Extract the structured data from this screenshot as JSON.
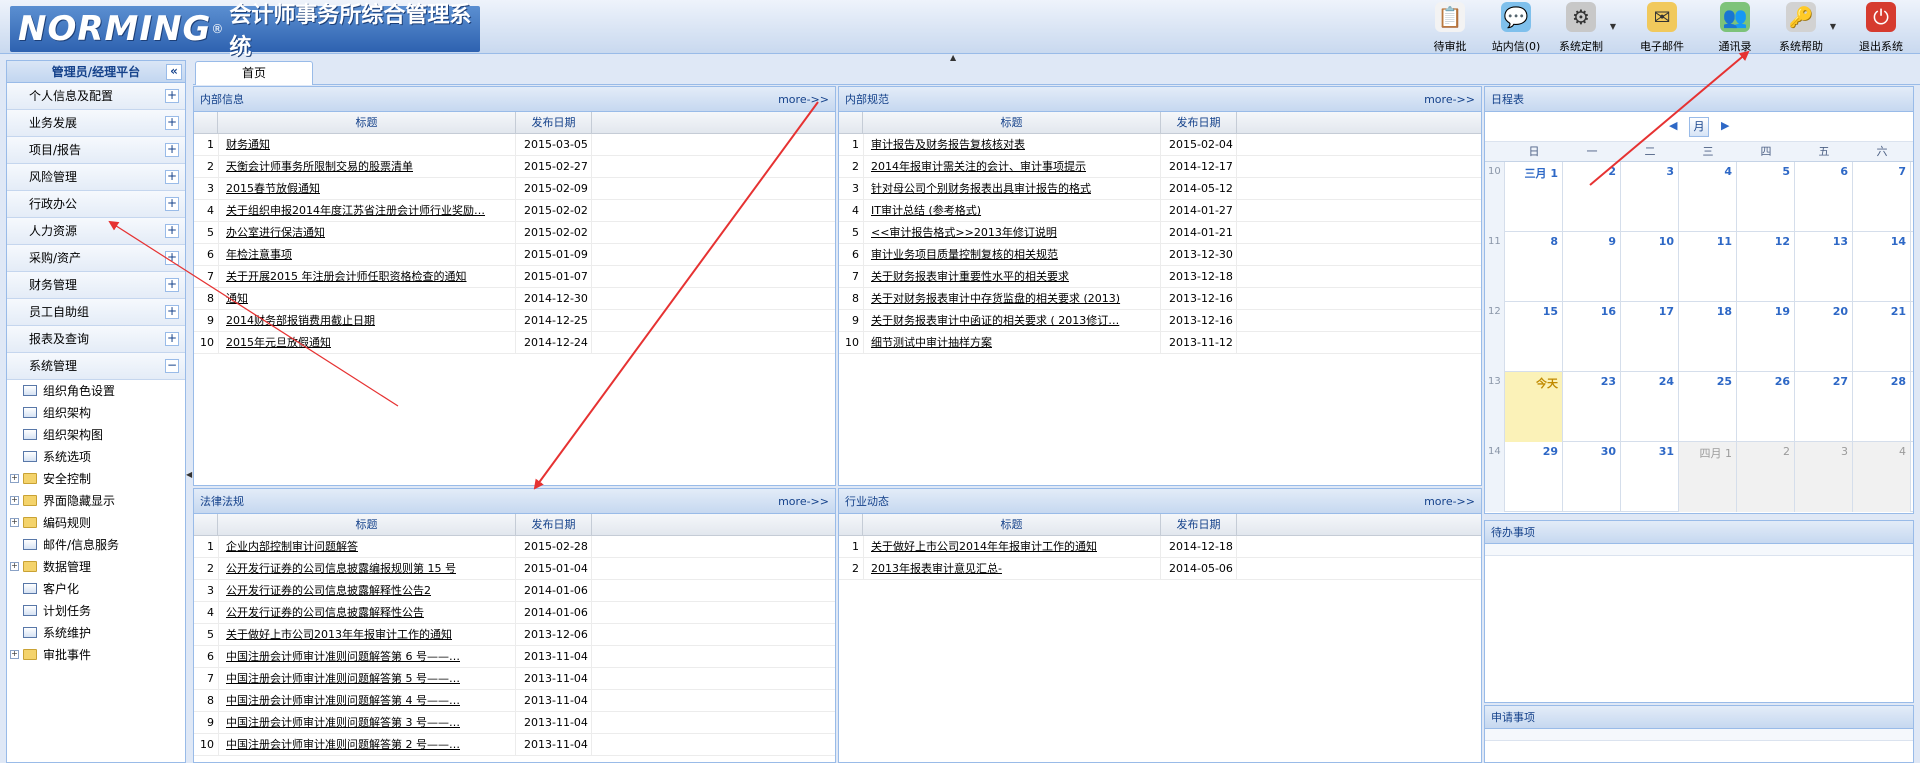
{
  "header": {
    "logo_brand": "NORMING",
    "logo_reg": "®",
    "logo_title": "会计师事务所综合管理系统",
    "tools": [
      {
        "label": "待审批",
        "icon": "clipboard-icon",
        "color": "#f3f3f3"
      },
      {
        "label": "站内信(0)",
        "icon": "chat-bubble-icon",
        "color": "#7fc0ec"
      },
      {
        "label": "系统定制",
        "icon": "gear-icon",
        "color": "#c8c8c8"
      },
      {
        "label": "电子邮件",
        "icon": "envelope-icon",
        "color": "#f1c95c"
      },
      {
        "label": "通讯录",
        "icon": "contacts-icon",
        "color": "#7dc37a"
      },
      {
        "label": "系统帮助",
        "icon": "key-icon",
        "color": "#d2d2d2"
      },
      {
        "label": "退出系统",
        "icon": "power-icon",
        "color": "#d63b2f"
      }
    ]
  },
  "left_nav": {
    "title": "管理员/经理平台",
    "collapse_symbol": "«",
    "plus_symbol": "+",
    "minus_symbol": "−",
    "menu_items": [
      "个人信息及配置",
      "业务发展",
      "项目/报告",
      "风险管理",
      "行政办公",
      "人力资源",
      "采购/资产",
      "财务管理",
      "员工自助组",
      "报表及查询",
      "系统管理"
    ],
    "tree_items": [
      {
        "label": "组织角色设置",
        "type": "doc"
      },
      {
        "label": "组织架构",
        "type": "doc"
      },
      {
        "label": "组织架构图",
        "type": "doc"
      },
      {
        "label": "系统选项",
        "type": "doc"
      },
      {
        "label": "安全控制",
        "type": "folder"
      },
      {
        "label": "界面隐藏显示",
        "type": "folder"
      },
      {
        "label": "编码规则",
        "type": "folder"
      },
      {
        "label": "邮件/信息服务",
        "type": "doc"
      },
      {
        "label": "数据管理",
        "type": "folder"
      },
      {
        "label": "客户化",
        "type": "doc"
      },
      {
        "label": "计划任务",
        "type": "doc"
      },
      {
        "label": "系统维护",
        "type": "doc"
      },
      {
        "label": "审批事件",
        "type": "folder"
      }
    ]
  },
  "tab": {
    "label": "首页"
  },
  "table_headers": {
    "title": "标题",
    "date": "发布日期"
  },
  "more_label": "more->>",
  "panels": [
    {
      "title": "内部信息",
      "rows": [
        [
          "1",
          "财务通知",
          "2015-03-05"
        ],
        [
          "2",
          "天衡会计师事务所限制交易的股票清单",
          "2015-02-27"
        ],
        [
          "3",
          "2015春节放假通知",
          "2015-02-09"
        ],
        [
          "4",
          "关于组织申报2014年度江苏省注册会计师行业奖励…",
          "2015-02-02"
        ],
        [
          "5",
          "办公室进行保洁通知",
          "2015-02-02"
        ],
        [
          "6",
          "年检注意事项",
          "2015-01-09"
        ],
        [
          "7",
          "关于开展2015 年注册会计师任职资格检查的通知",
          "2015-01-07"
        ],
        [
          "8",
          "通知",
          "2014-12-30"
        ],
        [
          "9",
          "2014财务部报销费用截止日期",
          "2014-12-25"
        ],
        [
          "10",
          "2015年元旦放假通知",
          "2014-12-24"
        ]
      ]
    },
    {
      "title": "内部规范",
      "rows": [
        [
          "1",
          "审计报告及财务报告复核核对表",
          "2015-02-04"
        ],
        [
          "2",
          "2014年报审计需关注的会计、审计事项提示",
          "2014-12-17"
        ],
        [
          "3",
          "针对母公司个别财务报表出具审计报告的格式",
          "2014-05-12"
        ],
        [
          "4",
          "IT审计总结 (参考格式)",
          "2014-01-27"
        ],
        [
          "5",
          "<<审计报告格式>>2013年修订说明",
          "2014-01-21"
        ],
        [
          "6",
          "审计业务项目质量控制复核的相关规范",
          "2013-12-30"
        ],
        [
          "7",
          "关于财务报表审计重要性水平的相关要求",
          "2013-12-18"
        ],
        [
          "8",
          "关于对财务报表审计中存货监盘的相关要求 (2013)",
          "2013-12-16"
        ],
        [
          "9",
          "关于财务报表审计中函证的相关要求 ( 2013修订…",
          "2013-12-16"
        ],
        [
          "10",
          "细节测试中审计抽样方案",
          "2013-11-12"
        ]
      ]
    },
    {
      "title": "法律法规",
      "rows": [
        [
          "1",
          "企业内部控制审计问题解答",
          "2015-02-28"
        ],
        [
          "2",
          "公开发行证券的公司信息披露编报规则第 15 号",
          "2015-01-04"
        ],
        [
          "3",
          "公开发行证券的公司信息披露解释性公告2",
          "2014-01-06"
        ],
        [
          "4",
          "公开发行证券的公司信息披露解释性公告",
          "2014-01-06"
        ],
        [
          "5",
          "关于做好上市公司2013年年报审计工作的通知",
          "2013-12-06"
        ],
        [
          "6",
          "中国注册会计师审计准则问题解答第 6 号——…",
          "2013-11-04"
        ],
        [
          "7",
          "中国注册会计师审计准则问题解答第 5 号——…",
          "2013-11-04"
        ],
        [
          "8",
          "中国注册会计师审计准则问题解答第 4 号——…",
          "2013-11-04"
        ],
        [
          "9",
          "中国注册会计师审计准则问题解答第 3 号——…",
          "2013-11-04"
        ],
        [
          "10",
          "中国注册会计师审计准则问题解答第 2 号——…",
          "2013-11-04"
        ]
      ]
    },
    {
      "title": "行业动态",
      "rows": [
        [
          "1",
          "关于做好上市公司2014年年报审计工作的通知",
          "2014-12-18"
        ],
        [
          "2",
          "2013年报表审计意见汇总-",
          "2014-05-06"
        ]
      ]
    }
  ],
  "calendar": {
    "title": "日程表",
    "prev": "◀",
    "next": "▶",
    "view": "月",
    "weekdays": [
      "日",
      "一",
      "二",
      "三",
      "四",
      "五",
      "六"
    ],
    "weeks": [
      {
        "num": "10",
        "days": [
          {
            "t": "三月 1",
            "s": ""
          },
          {
            "t": "2",
            "s": ""
          },
          {
            "t": "3",
            "s": ""
          },
          {
            "t": "4",
            "s": ""
          },
          {
            "t": "5",
            "s": ""
          },
          {
            "t": "6",
            "s": ""
          },
          {
            "t": "7",
            "s": ""
          }
        ]
      },
      {
        "num": "11",
        "days": [
          {
            "t": "8",
            "s": ""
          },
          {
            "t": "9",
            "s": ""
          },
          {
            "t": "10",
            "s": ""
          },
          {
            "t": "11",
            "s": ""
          },
          {
            "t": "12",
            "s": ""
          },
          {
            "t": "13",
            "s": ""
          },
          {
            "t": "14",
            "s": ""
          }
        ]
      },
      {
        "num": "12",
        "days": [
          {
            "t": "15",
            "s": ""
          },
          {
            "t": "16",
            "s": ""
          },
          {
            "t": "17",
            "s": ""
          },
          {
            "t": "18",
            "s": ""
          },
          {
            "t": "19",
            "s": ""
          },
          {
            "t": "20",
            "s": ""
          },
          {
            "t": "21",
            "s": ""
          }
        ]
      },
      {
        "num": "13",
        "days": [
          {
            "t": "今天",
            "s": "today"
          },
          {
            "t": "23",
            "s": ""
          },
          {
            "t": "24",
            "s": ""
          },
          {
            "t": "25",
            "s": ""
          },
          {
            "t": "26",
            "s": ""
          },
          {
            "t": "27",
            "s": ""
          },
          {
            "t": "28",
            "s": ""
          }
        ]
      },
      {
        "num": "14",
        "days": [
          {
            "t": "29",
            "s": ""
          },
          {
            "t": "30",
            "s": ""
          },
          {
            "t": "31",
            "s": ""
          },
          {
            "t": "四月 1",
            "s": "other"
          },
          {
            "t": "2",
            "s": "other"
          },
          {
            "t": "3",
            "s": "other"
          },
          {
            "t": "4",
            "s": "other"
          }
        ]
      }
    ]
  },
  "todo": {
    "title": "待办事项"
  },
  "requests": {
    "title": "申请事项"
  },
  "colors": {
    "annotation": "#e63232",
    "header_text": "#15428b",
    "link": "#2e68c6"
  }
}
